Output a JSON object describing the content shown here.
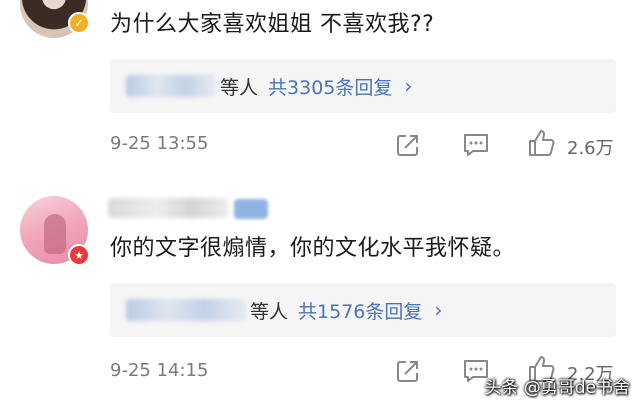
{
  "comments": [
    {
      "text": "为什么大家喜欢姐姐 不喜欢我??",
      "reply_by_suffix": "等人",
      "reply_count": "共3305条回复",
      "reply_chevron": "›",
      "timestamp": "9-25 13:55",
      "likes": "2.6万",
      "badge": "✓"
    },
    {
      "text": "你的文字很煽情，你的文化水平我怀疑。",
      "reply_by_suffix": "等人",
      "reply_count": "共1576条回复",
      "reply_chevron": "›",
      "timestamp": "9-25 14:15",
      "likes": "2.2万",
      "badge": "★"
    }
  ],
  "watermark": "头条 @勇哥de书舍",
  "icons": [
    "share-icon",
    "comment-icon",
    "like-icon",
    "verified-badge-icon",
    "star-badge-icon",
    "chevron-right-icon"
  ],
  "colors": {
    "link": "#4a73b8",
    "muted": "#7a7a7a",
    "reply_bg": "#f5f5f5",
    "badge_v": "#f2b01e",
    "badge_star": "#e83a3a"
  }
}
